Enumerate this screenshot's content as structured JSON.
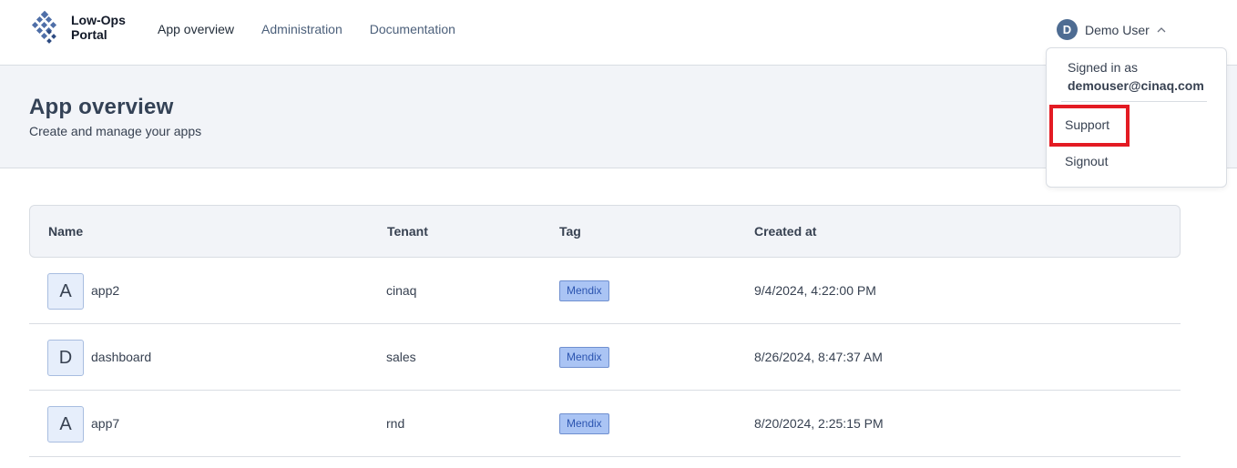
{
  "header": {
    "logo_line1": "Low-Ops",
    "logo_line2": "Portal",
    "nav": [
      "App overview",
      "Administration",
      "Documentation"
    ],
    "user": {
      "initial": "D",
      "name": "Demo User"
    }
  },
  "page": {
    "title": "App overview",
    "subtitle": "Create and manage your apps"
  },
  "table": {
    "columns": [
      "Name",
      "Tenant",
      "Tag",
      "Created at"
    ],
    "rows": [
      {
        "initial": "A",
        "name": "app2",
        "tenant": "cinaq",
        "tag": "Mendix",
        "created": "9/4/2024, 4:22:00 PM"
      },
      {
        "initial": "D",
        "name": "dashboard",
        "tenant": "sales",
        "tag": "Mendix",
        "created": "8/26/2024, 8:47:37 AM"
      },
      {
        "initial": "A",
        "name": "app7",
        "tenant": "rnd",
        "tag": "Mendix",
        "created": "8/20/2024, 2:25:15 PM"
      }
    ]
  },
  "dropdown": {
    "signed_in_label": "Signed in as",
    "email": "demouser@cinaq.com",
    "items": [
      "Support",
      "Signout"
    ]
  },
  "colors": {
    "accent": "#4e6c92",
    "highlight": "#e31b23",
    "tag_bg": "#aac4f4"
  }
}
